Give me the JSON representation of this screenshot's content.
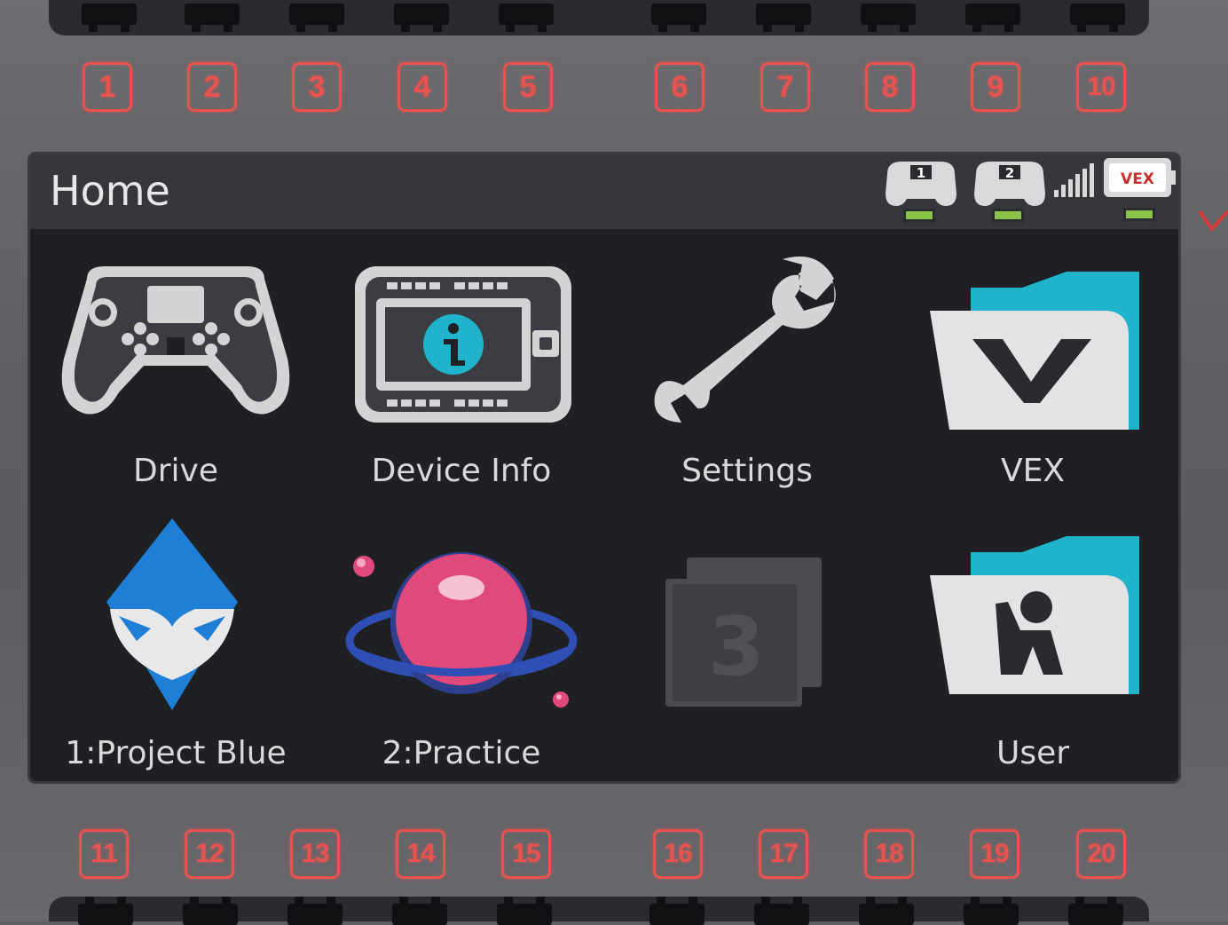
{
  "screen": {
    "title": "Home",
    "status": {
      "controller_1_label": "1",
      "controller_2_label": "2",
      "brain_logo_text": "VEX",
      "battery_color": "#8bc34a"
    },
    "apps": [
      {
        "label": "Drive",
        "icon": "gamepad-icon"
      },
      {
        "label": "Device Info",
        "icon": "device-info-icon"
      },
      {
        "label": "Settings",
        "icon": "wrench-icon"
      },
      {
        "label": "VEX",
        "icon": "vex-folder-icon"
      },
      {
        "label": "1:Project Blue",
        "icon": "blue-fox-project-icon"
      },
      {
        "label": "2:Practice",
        "icon": "planet-project-icon"
      },
      {
        "label": "",
        "icon": "slot-3-empty-icon",
        "slot_number": "3"
      },
      {
        "label": "User",
        "icon": "user-folder-icon"
      }
    ]
  },
  "ports": {
    "top": [
      "1",
      "2",
      "3",
      "4",
      "5",
      "6",
      "7",
      "8",
      "9",
      "10"
    ],
    "bottom": [
      "11",
      "12",
      "13",
      "14",
      "15",
      "16",
      "17",
      "18",
      "19",
      "20"
    ]
  },
  "colors": {
    "port_label": "#e8524f",
    "screen_bg": "#1e2024",
    "header_bg": "#35373b",
    "folder_teal": "#1fb4cc",
    "project_blue": "#1f7fd6",
    "planet_pink": "#e0497a"
  }
}
